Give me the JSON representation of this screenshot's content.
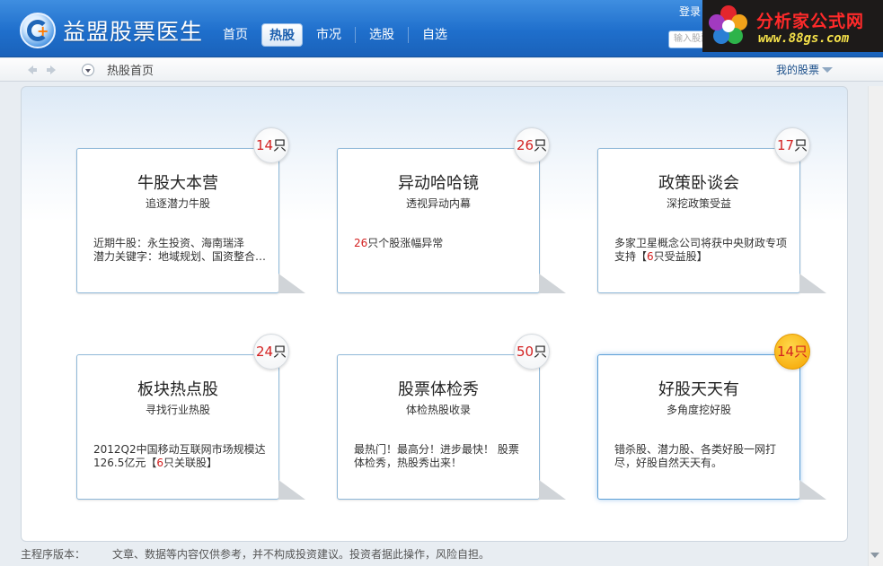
{
  "header": {
    "app_title": "益盟股票医生",
    "nav": [
      {
        "label": "首页",
        "active": false
      },
      {
        "label": "热股",
        "active": true
      },
      {
        "label": "市况",
        "active": false
      },
      {
        "label": "选股",
        "active": false
      },
      {
        "label": "自选",
        "active": false
      }
    ],
    "login_label": "登录",
    "search_placeholder": "输入股票",
    "watermark": {
      "line1": "分析家公式网",
      "line2": "www.88gs.com"
    }
  },
  "toolbar": {
    "breadcrumb": "热股首页",
    "my_stocks_label": "我的股票"
  },
  "cards": [
    {
      "title": "牛股大本营",
      "subtitle": "追逐潜力牛股",
      "count": "14",
      "unit": "只",
      "desc": "近期牛股：永生投资、海南瑞泽\n潜力关键字：地域规划、国资整合…",
      "highlight": false
    },
    {
      "title": "异动哈哈镜",
      "subtitle": "透视异动内幕",
      "count": "26",
      "unit": "只",
      "desc_num": "26",
      "desc_rest": "只个股涨幅异常",
      "highlight": false
    },
    {
      "title": "政策卧谈会",
      "subtitle": "深挖政策受益",
      "count": "17",
      "unit": "只",
      "desc_pre": "多家卫星概念公司将获中央财政专项支持【",
      "desc_num": "6",
      "desc_post": "只受益股】",
      "highlight": false
    },
    {
      "title": "板块热点股",
      "subtitle": "寻找行业热股",
      "count": "24",
      "unit": "只",
      "desc_pre": "2012Q2中国移动互联网市场规模达126.5亿元【",
      "desc_num": "6",
      "desc_post": "只关联股】",
      "highlight": false
    },
    {
      "title": "股票体检秀",
      "subtitle": "体检热股收录",
      "count": "50",
      "unit": "只",
      "desc": "最热门！最高分！进步最快！ 股票体检秀，热股秀出来！",
      "highlight": false
    },
    {
      "title": "好股天天有",
      "subtitle": "多角度挖好股",
      "count": "14",
      "unit": "只",
      "desc": "错杀股、潜力股、各类好股一网打尽，好股自然天天有。",
      "highlight": true
    }
  ],
  "footer": {
    "version_label": "主程序版本：",
    "disclaimer": "文章、数据等内容仅供参考，并不构成投资建议。投资者据此操作，风险自担。"
  },
  "colors": {
    "header_blue": "#1f6fcc",
    "accent_red": "#d32020",
    "badge_gold": "#f5a300"
  }
}
